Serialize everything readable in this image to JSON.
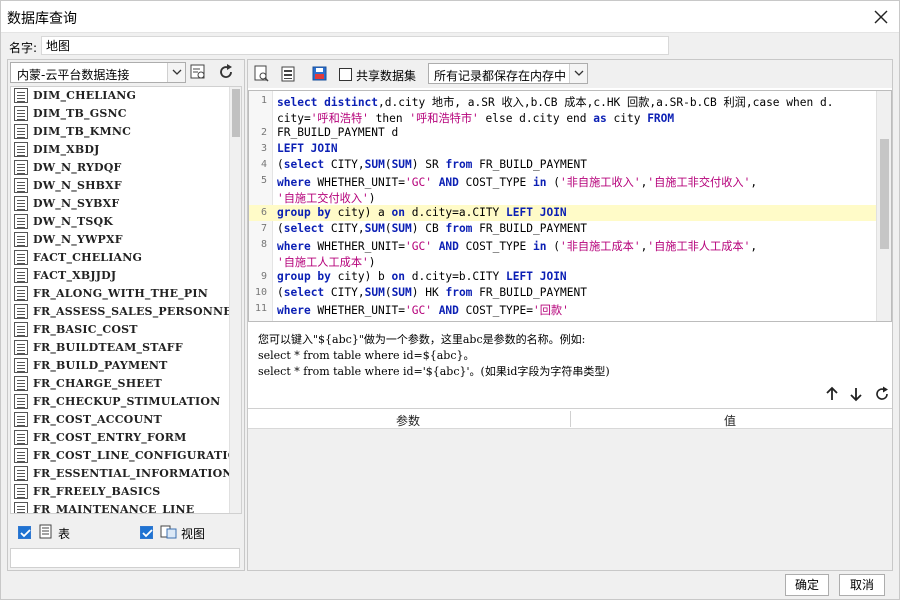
{
  "window": {
    "title": "数据库查询"
  },
  "name_field": {
    "label": "名字:",
    "value": "地图"
  },
  "left": {
    "datasource": "内蒙-云平台数据连接",
    "tables": [
      "DIM_CHELIANG",
      "DIM_TB_GSNC",
      "DIM_TB_KMNC",
      "DIM_XBDJ",
      "DW_N_RYDQF",
      "DW_N_SHBXF",
      "DW_N_SYBXF",
      "DW_N_TSQK",
      "DW_N_YWPXF",
      "FACT_CHELIANG",
      "FACT_XBJJDJ",
      "FR_ALONG_WITH_THE_PIN",
      "FR_ASSESS_SALES_PERSONNEL",
      "FR_BASIC_COST",
      "FR_BUILDTEAM_STAFF",
      "FR_BUILD_PAYMENT",
      "FR_CHARGE_SHEET",
      "FR_CHECKUP_STIMULATION",
      "FR_COST_ACCOUNT",
      "FR_COST_ENTRY_FORM",
      "FR_COST_LINE_CONFIGURATION",
      "FR_ESSENTIAL_INFORMATION",
      "FR_FREELY_BASICS",
      "FR_MAINTENANCE_LINE"
    ],
    "filter_table_label": "表",
    "filter_view_label": "视图"
  },
  "toolbar": {
    "share_label": "共享数据集",
    "memory_option": "所有记录都保存在内存中"
  },
  "sql_lines": [
    {
      "n": "1",
      "html": "<span class=\"kw\">select distinct</span>,d.city 地市, a.SR 收入,b.CB 成本,c.HK 回款,a.SR-b.CB 利润,case when d."
    },
    {
      "n": "",
      "html": "city=<span class=\"str\">'呼和浩特'</span> then <span class=\"str\">'呼和浩特市'</span> else d.city end <span class=\"kw\">as</span> city <span class=\"kw\">FROM</span>"
    },
    {
      "n": "2",
      "html": "FR_BUILD_PAYMENT d"
    },
    {
      "n": "3",
      "html": "<span class=\"kw\">LEFT JOIN</span>"
    },
    {
      "n": "4",
      "html": "(<span class=\"kw\">select</span> CITY,<span class=\"kw\">SUM</span>(<span class=\"kw\">SUM</span>) SR <span class=\"kw\">from</span> FR_BUILD_PAYMENT"
    },
    {
      "n": "5",
      "html": "<span class=\"kw\">where</span> WHETHER_UNIT=<span class=\"str\">'GC'</span> <span class=\"kw\">AND</span> COST_TYPE <span class=\"kw\">in</span> (<span class=\"str\">'非自施工收入'</span>,<span class=\"str\">'自施工非交付收入'</span>,"
    },
    {
      "n": "",
      "html": "<span class=\"str\">'自施工交付收入'</span>)"
    },
    {
      "n": "6",
      "html": "<span class=\"kw\">group by</span> city) a <span class=\"kw\">on</span> d.city=a.CITY <span class=\"kw\">LEFT JOIN</span>",
      "hl": true
    },
    {
      "n": "7",
      "html": "(<span class=\"kw\">select</span> CITY,<span class=\"kw\">SUM</span>(<span class=\"kw\">SUM</span>) CB <span class=\"kw\">from</span> FR_BUILD_PAYMENT"
    },
    {
      "n": "8",
      "html": "<span class=\"kw\">where</span> WHETHER_UNIT=<span class=\"str\">'GC'</span> <span class=\"kw\">AND</span> COST_TYPE <span class=\"kw\">in</span> (<span class=\"str\">'非自施工成本'</span>,<span class=\"str\">'自施工非人工成本'</span>,"
    },
    {
      "n": "",
      "html": "<span class=\"str\">'自施工人工成本'</span>)"
    },
    {
      "n": "9",
      "html": "<span class=\"kw\">group by</span> city) b <span class=\"kw\">on</span> d.city=b.CITY <span class=\"kw\">LEFT JOIN</span>"
    },
    {
      "n": "10",
      "html": "(<span class=\"kw\">select</span> CITY,<span class=\"kw\">SUM</span>(<span class=\"kw\">SUM</span>) HK <span class=\"kw\">from</span> FR_BUILD_PAYMENT"
    },
    {
      "n": "11",
      "html": "<span class=\"kw\">where</span> WHETHER_UNIT=<span class=\"str\">'GC'</span> <span class=\"kw\">AND</span> COST_TYPE=<span class=\"str\">'回款'</span>"
    }
  ],
  "hint": {
    "line1": "您可以键入\"${abc}\"做为一个参数，这里abc是参数的名称。例如:",
    "line2": "select * from table where id=${abc}。",
    "line3": "select * from table where id='${abc}'。(如果id字段为字符串类型)"
  },
  "param_table": {
    "col_param": "参数",
    "col_value": "值"
  },
  "buttons": {
    "ok": "确定",
    "cancel": "取消"
  }
}
